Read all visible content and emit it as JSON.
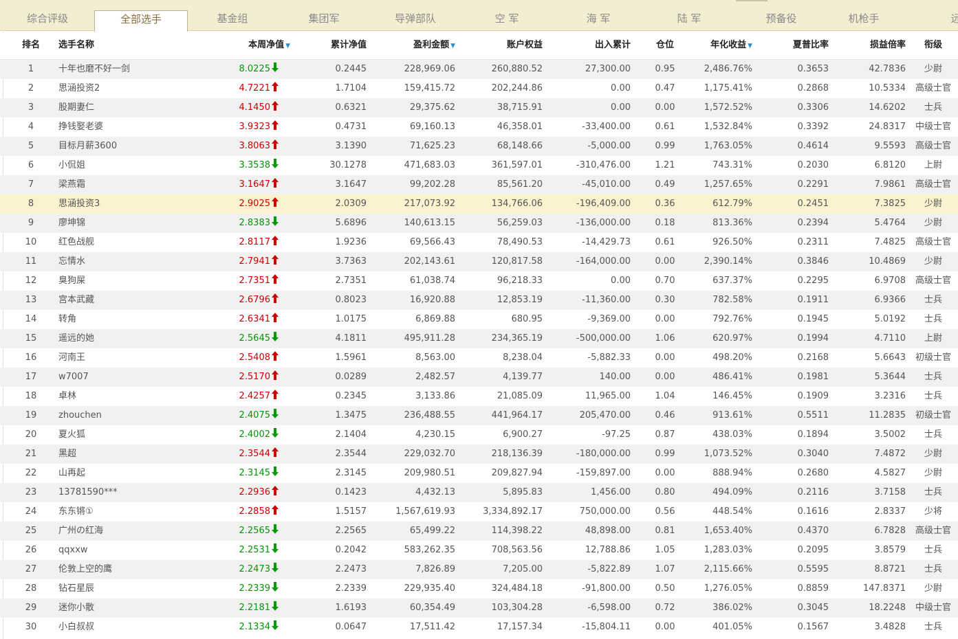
{
  "tabs": [
    "综合评级",
    "全部选手",
    "基金组",
    "集团军",
    "导弹部队",
    "空 军",
    "海 军",
    "陆 军",
    "预备役",
    "机枪手",
    "远"
  ],
  "active_tab": 1,
  "headers": {
    "rank": "排名",
    "name": "选手名称",
    "week_nav": "本周净值",
    "cum_nav": "累计净值",
    "profit": "盈利金额",
    "equity": "账户权益",
    "inout": "出入累计",
    "position": "仓位",
    "annual": "年化收益",
    "sharpe": "夏普比率",
    "pl_ratio": "损益倍率",
    "rankname": "衔级"
  },
  "colors": {
    "up": "#cc0000",
    "down": "#009900",
    "sort": "#2a8fd6"
  },
  "highlight_row": 8,
  "rows": [
    {
      "rank": "1",
      "name": "十年也磨不好一剑",
      "nav": "8.0225",
      "dir": "down",
      "cum": "0.2445",
      "profit": "228,969.06",
      "equity": "260,880.52",
      "inout": "27,300.00",
      "pos": "0.95",
      "annual": "2,486.76%",
      "sharpe": "0.3653",
      "pl": "42.7836",
      "title": "少尉"
    },
    {
      "rank": "2",
      "name": "思涵投资2",
      "nav": "4.7221",
      "dir": "up",
      "cum": "1.7104",
      "profit": "159,415.72",
      "equity": "202,244.86",
      "inout": "0.00",
      "pos": "0.47",
      "annual": "1,175.41%",
      "sharpe": "0.2868",
      "pl": "10.5334",
      "title": "高级士官"
    },
    {
      "rank": "3",
      "name": "股期妻仁",
      "nav": "4.1450",
      "dir": "up",
      "cum": "0.6321",
      "profit": "29,375.62",
      "equity": "38,715.91",
      "inout": "0.00",
      "pos": "0.00",
      "annual": "1,572.52%",
      "sharpe": "0.3306",
      "pl": "14.6202",
      "title": "士兵"
    },
    {
      "rank": "4",
      "name": "挣钱娶老婆",
      "nav": "3.9323",
      "dir": "up",
      "cum": "0.4731",
      "profit": "69,160.13",
      "equity": "46,358.01",
      "inout": "-33,400.00",
      "pos": "0.61",
      "annual": "1,532.84%",
      "sharpe": "0.3392",
      "pl": "24.8317",
      "title": "中级士官"
    },
    {
      "rank": "5",
      "name": "目标月薪3600",
      "nav": "3.8063",
      "dir": "up",
      "cum": "3.1390",
      "profit": "71,625.23",
      "equity": "68,148.66",
      "inout": "-5,000.00",
      "pos": "0.99",
      "annual": "1,763.05%",
      "sharpe": "0.4614",
      "pl": "9.5593",
      "title": "高级士官"
    },
    {
      "rank": "6",
      "name": "小侃姐",
      "nav": "3.3538",
      "dir": "down",
      "cum": "30.1278",
      "profit": "471,683.03",
      "equity": "361,597.01",
      "inout": "-310,476.00",
      "pos": "1.21",
      "annual": "743.31%",
      "sharpe": "0.2030",
      "pl": "6.8120",
      "title": "上尉"
    },
    {
      "rank": "7",
      "name": "梁燕霜",
      "nav": "3.1647",
      "dir": "up",
      "cum": "3.1647",
      "profit": "99,202.28",
      "equity": "85,561.20",
      "inout": "-45,010.00",
      "pos": "0.49",
      "annual": "1,257.65%",
      "sharpe": "0.2291",
      "pl": "7.9861",
      "title": "高级士官"
    },
    {
      "rank": "8",
      "name": "思涵投资3",
      "nav": "2.9025",
      "dir": "up",
      "cum": "2.0309",
      "profit": "217,073.92",
      "equity": "134,766.06",
      "inout": "-196,409.00",
      "pos": "0.36",
      "annual": "612.79%",
      "sharpe": "0.2451",
      "pl": "7.3825",
      "title": "少尉"
    },
    {
      "rank": "9",
      "name": "廖坤锦",
      "nav": "2.8383",
      "dir": "down",
      "cum": "5.6896",
      "profit": "140,613.15",
      "equity": "56,259.03",
      "inout": "-136,000.00",
      "pos": "0.18",
      "annual": "813.36%",
      "sharpe": "0.2394",
      "pl": "5.4764",
      "title": "少尉"
    },
    {
      "rank": "10",
      "name": "红色战舰",
      "nav": "2.8117",
      "dir": "up",
      "cum": "1.9236",
      "profit": "69,566.43",
      "equity": "78,490.53",
      "inout": "-14,429.73",
      "pos": "0.61",
      "annual": "926.50%",
      "sharpe": "0.2311",
      "pl": "7.4825",
      "title": "高级士官"
    },
    {
      "rank": "11",
      "name": "忘情水",
      "nav": "2.7941",
      "dir": "up",
      "cum": "3.7363",
      "profit": "202,143.61",
      "equity": "120,817.58",
      "inout": "-164,000.00",
      "pos": "0.00",
      "annual": "2,390.14%",
      "sharpe": "0.3846",
      "pl": "10.4869",
      "title": "少尉"
    },
    {
      "rank": "12",
      "name": "臭狗屎",
      "nav": "2.7351",
      "dir": "up",
      "cum": "2.7351",
      "profit": "61,038.74",
      "equity": "96,218.33",
      "inout": "0.00",
      "pos": "0.70",
      "annual": "637.37%",
      "sharpe": "0.2295",
      "pl": "6.9708",
      "title": "高级士官"
    },
    {
      "rank": "13",
      "name": "宫本武藏",
      "nav": "2.6796",
      "dir": "up",
      "cum": "0.8023",
      "profit": "16,920.88",
      "equity": "12,853.19",
      "inout": "-11,360.00",
      "pos": "0.30",
      "annual": "782.58%",
      "sharpe": "0.1911",
      "pl": "6.9366",
      "title": "士兵"
    },
    {
      "rank": "14",
      "name": "转角",
      "nav": "2.6341",
      "dir": "up",
      "cum": "1.0175",
      "profit": "6,869.88",
      "equity": "680.95",
      "inout": "-9,369.00",
      "pos": "0.00",
      "annual": "792.76%",
      "sharpe": "0.1945",
      "pl": "5.0192",
      "title": "士兵"
    },
    {
      "rank": "15",
      "name": "遥远的她",
      "nav": "2.5645",
      "dir": "down",
      "cum": "4.1811",
      "profit": "495,911.28",
      "equity": "234,365.19",
      "inout": "-500,000.00",
      "pos": "1.06",
      "annual": "620.97%",
      "sharpe": "0.1994",
      "pl": "4.7110",
      "title": "上尉"
    },
    {
      "rank": "16",
      "name": "河南王",
      "nav": "2.5408",
      "dir": "up",
      "cum": "1.5961",
      "profit": "8,563.00",
      "equity": "8,238.04",
      "inout": "-5,882.33",
      "pos": "0.00",
      "annual": "498.20%",
      "sharpe": "0.2168",
      "pl": "5.6643",
      "title": "初级士官"
    },
    {
      "rank": "17",
      "name": "w7007",
      "nav": "2.5170",
      "dir": "up",
      "cum": "0.0289",
      "profit": "2,482.57",
      "equity": "4,139.77",
      "inout": "140.00",
      "pos": "0.00",
      "annual": "486.41%",
      "sharpe": "0.1981",
      "pl": "5.3644",
      "title": "士兵"
    },
    {
      "rank": "18",
      "name": "卓林",
      "nav": "2.4257",
      "dir": "up",
      "cum": "0.2345",
      "profit": "3,133.86",
      "equity": "21,085.09",
      "inout": "11,965.00",
      "pos": "1.04",
      "annual": "146.45%",
      "sharpe": "0.1909",
      "pl": "3.2316",
      "title": "士兵"
    },
    {
      "rank": "19",
      "name": "zhouchen",
      "nav": "2.4075",
      "dir": "down",
      "cum": "1.3475",
      "profit": "236,488.55",
      "equity": "441,964.17",
      "inout": "205,470.00",
      "pos": "0.46",
      "annual": "913.61%",
      "sharpe": "0.5511",
      "pl": "11.2835",
      "title": "初级士官"
    },
    {
      "rank": "20",
      "name": "夏火狐",
      "nav": "2.4002",
      "dir": "down",
      "cum": "2.1404",
      "profit": "4,230.15",
      "equity": "6,900.27",
      "inout": "-97.25",
      "pos": "0.87",
      "annual": "438.03%",
      "sharpe": "0.1894",
      "pl": "3.5002",
      "title": "士兵"
    },
    {
      "rank": "21",
      "name": "黑超",
      "nav": "2.3544",
      "dir": "up",
      "cum": "2.3544",
      "profit": "229,032.70",
      "equity": "218,136.39",
      "inout": "-180,000.00",
      "pos": "0.99",
      "annual": "1,073.52%",
      "sharpe": "0.3040",
      "pl": "7.4872",
      "title": "少尉"
    },
    {
      "rank": "22",
      "name": "山再起",
      "nav": "2.3145",
      "dir": "down",
      "cum": "2.3145",
      "profit": "209,980.51",
      "equity": "209,827.94",
      "inout": "-159,897.00",
      "pos": "0.00",
      "annual": "888.94%",
      "sharpe": "0.2680",
      "pl": "4.5827",
      "title": "少尉"
    },
    {
      "rank": "23",
      "name": "13781590***",
      "nav": "2.2936",
      "dir": "up",
      "cum": "0.1423",
      "profit": "4,432.13",
      "equity": "5,895.83",
      "inout": "1,456.00",
      "pos": "0.80",
      "annual": "494.09%",
      "sharpe": "0.2116",
      "pl": "3.7158",
      "title": "士兵"
    },
    {
      "rank": "24",
      "name": "东东锵①",
      "nav": "2.2858",
      "dir": "up",
      "cum": "1.5157",
      "profit": "1,567,619.93",
      "equity": "3,334,892.17",
      "inout": "750,000.00",
      "pos": "0.56",
      "annual": "448.54%",
      "sharpe": "0.1616",
      "pl": "2.8337",
      "title": "少将"
    },
    {
      "rank": "25",
      "name": "广州の红海",
      "nav": "2.2565",
      "dir": "down",
      "cum": "2.2565",
      "profit": "65,499.22",
      "equity": "114,398.22",
      "inout": "48,898.00",
      "pos": "0.81",
      "annual": "1,653.40%",
      "sharpe": "0.4370",
      "pl": "6.7828",
      "title": "高级士官"
    },
    {
      "rank": "26",
      "name": "qqxxw",
      "nav": "2.2531",
      "dir": "down",
      "cum": "0.2042",
      "profit": "583,262.35",
      "equity": "708,563.56",
      "inout": "12,788.86",
      "pos": "1.05",
      "annual": "1,283.03%",
      "sharpe": "0.2095",
      "pl": "3.8579",
      "title": "士兵"
    },
    {
      "rank": "27",
      "name": "伦敦上空的鹰",
      "nav": "2.2473",
      "dir": "down",
      "cum": "2.2473",
      "profit": "7,826.89",
      "equity": "7,205.00",
      "inout": "-5,822.89",
      "pos": "1.07",
      "annual": "2,115.66%",
      "sharpe": "0.5595",
      "pl": "8.8721",
      "title": "士兵"
    },
    {
      "rank": "28",
      "name": "钻石星辰",
      "nav": "2.2339",
      "dir": "down",
      "cum": "2.2339",
      "profit": "229,935.40",
      "equity": "324,484.18",
      "inout": "-91,800.00",
      "pos": "0.50",
      "annual": "1,276.05%",
      "sharpe": "0.8859",
      "pl": "147.8371",
      "title": "少尉"
    },
    {
      "rank": "29",
      "name": "迷你小散",
      "nav": "2.2181",
      "dir": "down",
      "cum": "1.6193",
      "profit": "60,354.49",
      "equity": "103,304.28",
      "inout": "-6,598.00",
      "pos": "0.72",
      "annual": "386.02%",
      "sharpe": "0.3045",
      "pl": "18.2248",
      "title": "中级士官"
    },
    {
      "rank": "30",
      "name": "小白叔叔",
      "nav": "2.1334",
      "dir": "down",
      "cum": "0.0647",
      "profit": "17,511.42",
      "equity": "17,157.34",
      "inout": "-15,804.11",
      "pos": "0.00",
      "annual": "401.05%",
      "sharpe": "0.1567",
      "pl": "3.4828",
      "title": "士兵"
    }
  ]
}
